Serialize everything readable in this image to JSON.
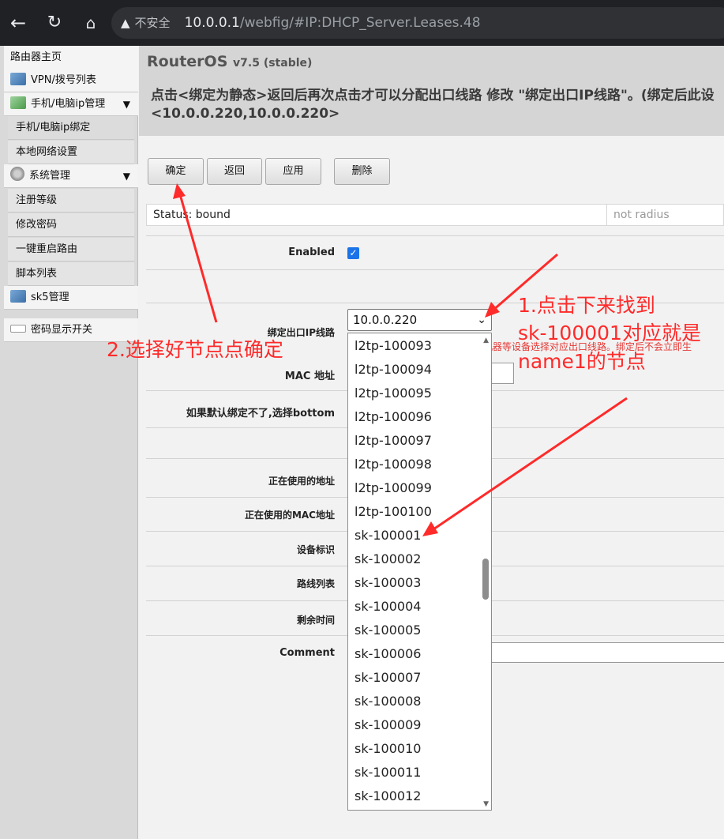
{
  "browser": {
    "back_icon": "back-arrow-icon",
    "reload_icon": "reload-icon",
    "home_icon": "home-icon",
    "security_label": "不安全",
    "url_host": "10.0.0.1",
    "url_path": "/webfig/#IP:DHCP_Server.Leases.48"
  },
  "sidebar": {
    "items": [
      {
        "label": "路由器主页"
      },
      {
        "label": "VPN/拨号列表"
      },
      {
        "label": "手机/电脑ip管理",
        "arrow": "▼"
      },
      {
        "label": "手机/电脑ip绑定"
      },
      {
        "label": "本地网络设置"
      },
      {
        "label": "系统管理",
        "arrow": "▼"
      },
      {
        "label": "注册等级"
      },
      {
        "label": "修改密码"
      },
      {
        "label": "一键重启路由"
      },
      {
        "label": "脚本列表"
      },
      {
        "label": "sk5管理"
      },
      {
        "label": "密码显示开关"
      }
    ]
  },
  "header": {
    "brand": "RouterOS",
    "version": "v7.5 (stable)",
    "notice_line1": "点击<绑定为静态>返回后再次点击才可以分配出口线路 修改 \"绑定出口IP线路\"。(绑定后此设",
    "notice_line2": "<10.0.0.220,10.0.0.220>"
  },
  "buttons": {
    "confirm": "确定",
    "back": "返回",
    "apply": "应用",
    "delete": "删除"
  },
  "status": {
    "text": "Status: bound",
    "radius": "not radius"
  },
  "form": {
    "enabled_label": "Enabled",
    "enabled_checked": true,
    "line_label": "绑定出口IP线路",
    "line_value": "10.0.0.220",
    "line_note": "机器等设备选择对应出口线路。绑定后不会立即生",
    "mac_label": "MAC 地址",
    "bottom_label": "如果默认绑定不了,选择bottom",
    "in_use_addr_label": "正在使用的地址",
    "in_use_mac_label": "正在使用的MAC地址",
    "device_id_label": "设备标识",
    "route_list_label": "路线列表",
    "remaining_label": "剩余时间",
    "comment_label": "Comment"
  },
  "dropdown": {
    "options": [
      "l2tp-100093",
      "l2tp-100094",
      "l2tp-100095",
      "l2tp-100096",
      "l2tp-100097",
      "l2tp-100098",
      "l2tp-100099",
      "l2tp-100100",
      "sk-100001",
      "sk-100002",
      "sk-100003",
      "sk-100004",
      "sk-100005",
      "sk-100006",
      "sk-100007",
      "sk-100008",
      "sk-100009",
      "sk-100010",
      "sk-100011",
      "sk-100012"
    ]
  },
  "annotations": {
    "note1_line1": "1.点击下来找到",
    "note1_line2": "sk-100001对应就是",
    "note1_line3": "name1的节点",
    "note2": "2.选择好节点点确定",
    "color": "#ff2a2a"
  }
}
